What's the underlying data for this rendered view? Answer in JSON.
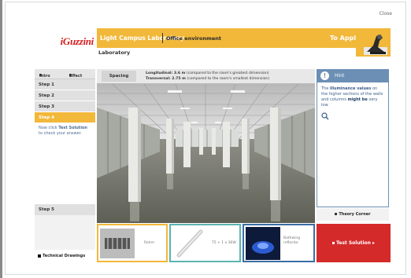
{
  "window": {
    "close_label": "Close"
  },
  "header": {
    "logo": "iGuzzini",
    "app_title": "Light Campus Laboratory",
    "section": "Office environment",
    "action": "To Apply",
    "subtitle": "Laboratory"
  },
  "sidebar": {
    "tabs": [
      "Intro",
      "Effect"
    ],
    "steps": [
      "Step 1",
      "Step 2",
      "Step 3",
      "Step 4"
    ],
    "active_step": "Step 4",
    "instruction_pre": "Now click ",
    "instruction_bold": "Test Solution",
    "instruction_post": " to check your answer.",
    "step5": "Step 5",
    "technical_drawings": "Technical Drawings"
  },
  "viewer": {
    "spacing_label": "Spacing",
    "longitudinal_label": "Longitudinal: 3.6 m",
    "longitudinal_text": " (compared to the room's greatest dimension)",
    "transversal_label": "Transversal: 2.75 m",
    "transversal_text": " (compared to the room's smallest dimension)"
  },
  "hint": {
    "title": "Hint",
    "text_1": "The ",
    "text_bold_1": "illuminance values",
    "text_2": " on the higher sections of the walls and columns ",
    "text_blue": "might be",
    "text_3": " very low.",
    "icon": "magnifier-icon"
  },
  "theory_corner": "Theory Corner",
  "thumbnails": [
    {
      "label": "Rohm"
    },
    {
      "label": "T5 + 1 x 36W"
    },
    {
      "label": "Bathwing reflector"
    }
  ],
  "test_solution": "Test Solution",
  "colors": {
    "accent": "#f2b83a",
    "hint": "#6b8fb5",
    "test": "#d42a2a",
    "logo": "#d41e1e"
  }
}
